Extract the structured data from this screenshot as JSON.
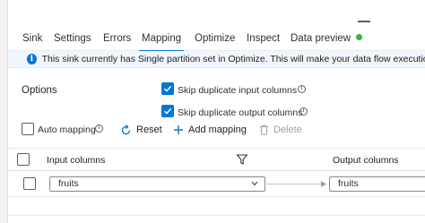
{
  "tabs": [
    {
      "label": "Sink",
      "active": false
    },
    {
      "label": "Settings",
      "active": false
    },
    {
      "label": "Errors",
      "active": false
    },
    {
      "label": "Mapping",
      "active": true
    },
    {
      "label": "Optimize",
      "active": false
    },
    {
      "label": "Inspect",
      "active": false
    },
    {
      "label": "Data preview",
      "active": false,
      "status_color": "#3cb043"
    }
  ],
  "banner": {
    "icon": "info-icon",
    "text": "This sink currently has Single partition set in Optimize. This will make your data flow execution longer. Tu"
  },
  "options": {
    "label": "Options",
    "skip_duplicate_input": {
      "label": "Skip duplicate input columns",
      "checked": true
    },
    "skip_duplicate_output": {
      "label": "Skip duplicate output columns",
      "checked": true
    },
    "auto_mapping": {
      "label": "Auto mapping",
      "checked": false
    }
  },
  "actions": {
    "reset": "Reset",
    "add_mapping": "Add mapping",
    "delete": "Delete"
  },
  "grid": {
    "input_header": "Input columns",
    "output_header": "Output columns",
    "rows": [
      {
        "input": "fruits",
        "output": "fruits"
      }
    ]
  },
  "colors": {
    "accent": "#0078d4",
    "banner_bg": "#f0f6ff",
    "status_ok": "#3cb043"
  }
}
